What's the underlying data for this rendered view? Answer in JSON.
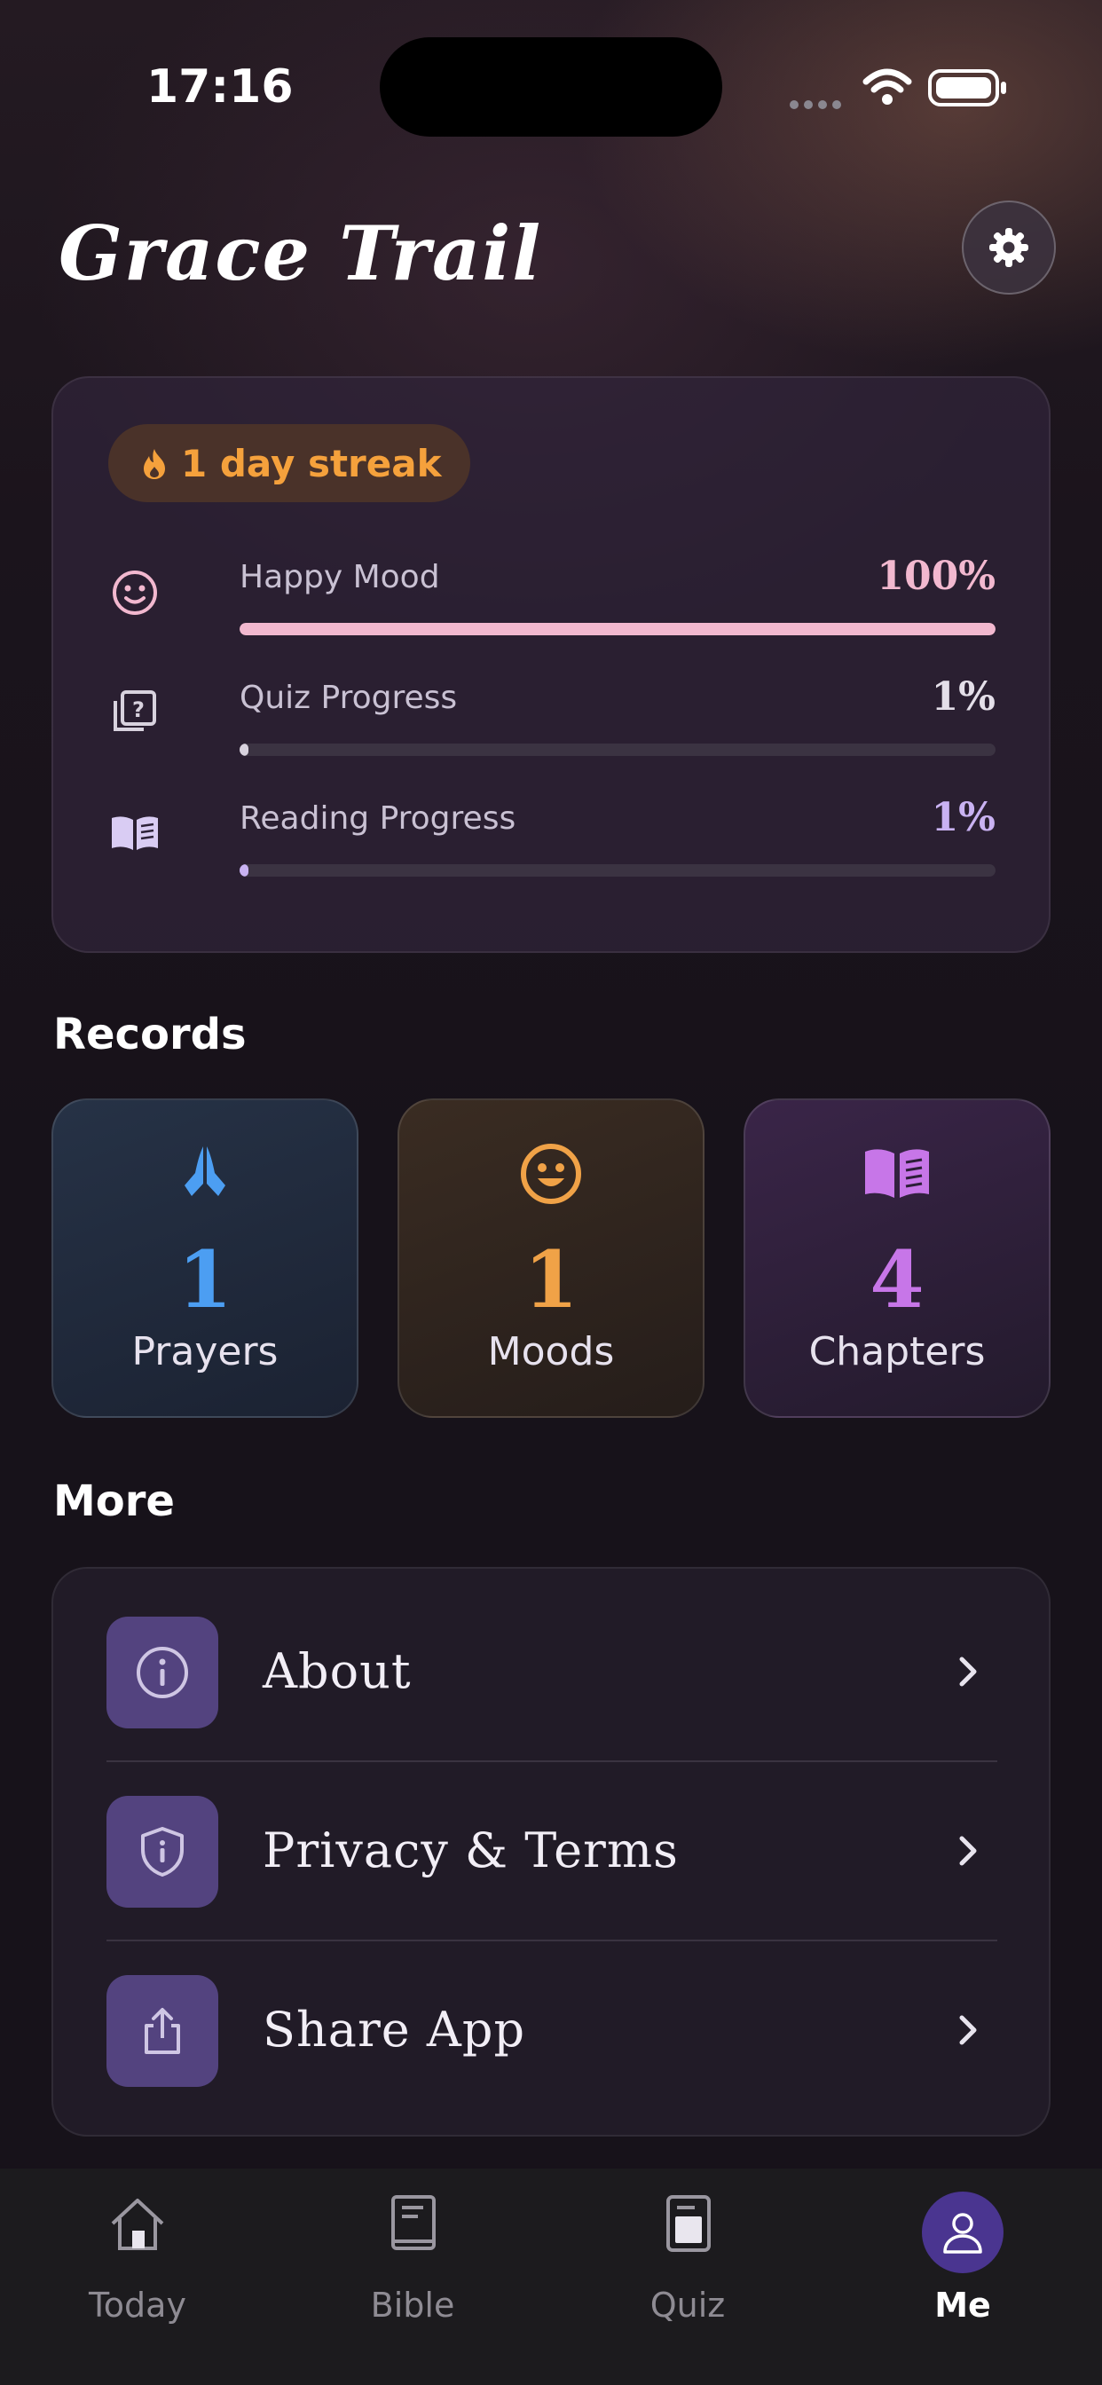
{
  "status_bar": {
    "time": "17:16"
  },
  "app": {
    "title": "Grace Trail"
  },
  "stats": {
    "streak_label": "1 day streak",
    "metrics": [
      {
        "label": "Happy Mood",
        "value": "100%",
        "fraction": 1.0,
        "color": "#f2b8cf",
        "icon": "smile-icon"
      },
      {
        "label": "Quiz Progress",
        "value": "1%",
        "fraction": 0.01,
        "color": "#d8d2de",
        "icon": "quiz-icon"
      },
      {
        "label": "Reading Progress",
        "value": "1%",
        "fraction": 0.01,
        "color": "#c9b2f2",
        "icon": "book-open-icon"
      }
    ]
  },
  "records": {
    "title": "Records",
    "items": [
      {
        "count": "1",
        "label": "Prayers",
        "color": "#4c9ef2",
        "icon": "praying-hands-icon"
      },
      {
        "count": "1",
        "label": "Moods",
        "color": "#f0a247",
        "icon": "smile-icon"
      },
      {
        "count": "4",
        "label": "Chapters",
        "color": "#c776e8",
        "icon": "book-open-icon"
      }
    ]
  },
  "more": {
    "title": "More",
    "items": [
      {
        "label": "About",
        "icon": "info-icon"
      },
      {
        "label": "Privacy & Terms",
        "icon": "shield-icon"
      },
      {
        "label": "Share App",
        "icon": "share-icon"
      }
    ]
  },
  "tabs": [
    {
      "label": "Today",
      "icon": "home-icon",
      "active": false
    },
    {
      "label": "Bible",
      "icon": "bible-icon",
      "active": false
    },
    {
      "label": "Quiz",
      "icon": "quiz-card-icon",
      "active": false
    },
    {
      "label": "Me",
      "icon": "person-icon",
      "active": true
    }
  ]
}
